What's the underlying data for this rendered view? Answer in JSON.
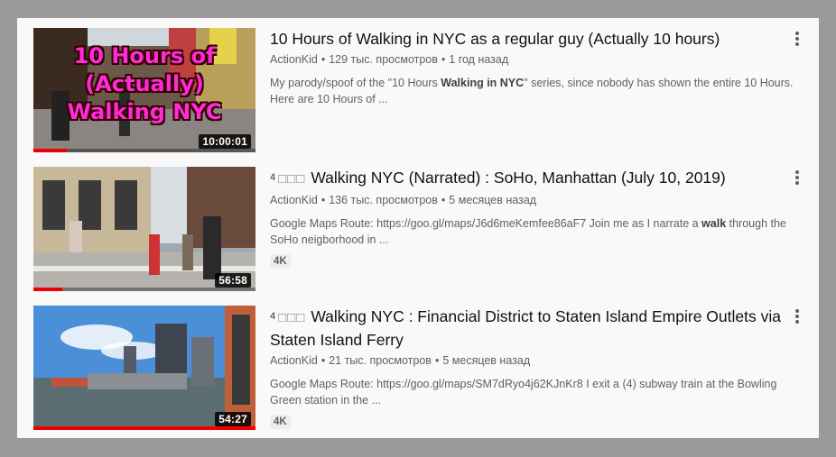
{
  "videos": [
    {
      "title": "10 Hours of Walking in NYC as a regular guy (Actually 10 hours)",
      "title_prefix": "",
      "title_boxes": "",
      "channel": "ActionKid",
      "views": "129 тыс. просмотров",
      "age": "1 год назад",
      "description_parts": [
        "My parody/spoof of the \"10 Hours ",
        "Walking in NYC",
        "\" series, since nobody has shown the entire 10 Hours. Here are 10 Hours of ..."
      ],
      "badge": "",
      "duration": "10:00:01",
      "progress": 0.15,
      "thumb_overlay": [
        "10 Hours of",
        "(Actually)",
        "Walking NYC"
      ],
      "thumb_overlay_color": "#ff2bd6"
    },
    {
      "title": "Walking NYC (Narrated) : SoHo, Manhattan (July 10, 2019)",
      "title_prefix": "4",
      "title_boxes": "□□□",
      "channel": "ActionKid",
      "views": "136 тыс. просмотров",
      "age": "5 месяцев назад",
      "description_parts": [
        "Google Maps Route: https://goo.gl/maps/J6d6meKemfee86aF7 Join me as I narrate a ",
        "walk",
        " through the SoHo neigborhood in ..."
      ],
      "badge": "4K",
      "duration": "56:58",
      "progress": 0.13
    },
    {
      "title": "Walking NYC : Financial District to Staten Island Empire Outlets via Staten Island Ferry",
      "title_prefix": "4",
      "title_boxes": "□□□",
      "channel": "ActionKid",
      "views": "21 тыс. просмотров",
      "age": "5 месяцев назад",
      "description_parts": [
        "Google Maps Route: https://goo.gl/maps/SM7dRyo4j62KJnKr8 I exit a (4) subway train at the Bowling Green station in the ...",
        "",
        ""
      ],
      "badge": "4K",
      "duration": "54:27",
      "progress": 1.0
    }
  ],
  "icons": {
    "more": "more-vertical-icon"
  },
  "colors": {
    "progress": "#e00000",
    "overlay_text": "#ff2bd6"
  }
}
